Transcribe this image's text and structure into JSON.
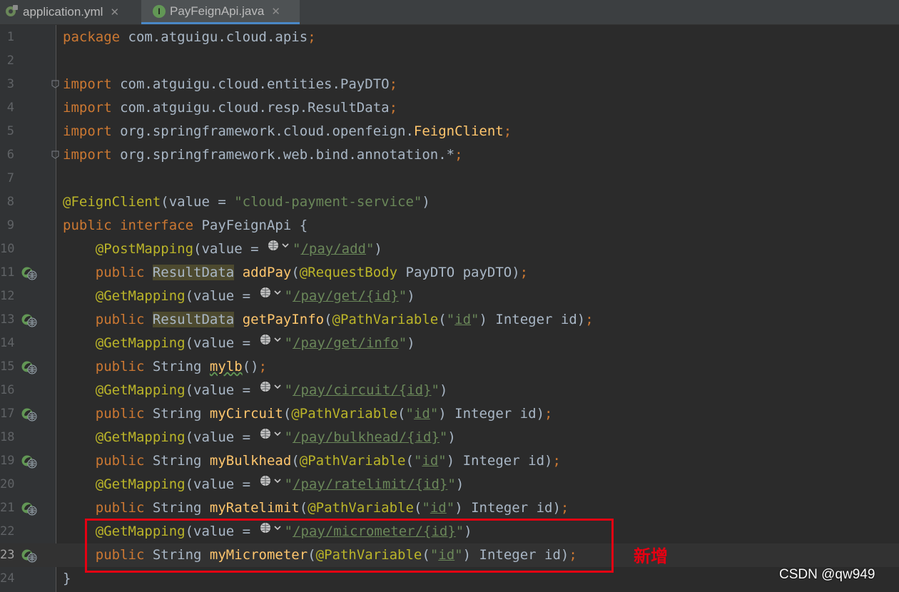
{
  "tabs": [
    {
      "label": "application.yml",
      "icon": "yml-file-icon",
      "active": false
    },
    {
      "label": "PayFeignApi.java",
      "icon": "java-interface-icon",
      "badge": "I",
      "active": true
    }
  ],
  "editor": {
    "current_line": 23,
    "lines": [
      {
        "n": "1",
        "tokens": [
          [
            "kw",
            "package"
          ],
          [
            "p",
            " com.atguigu.cloud.apis"
          ],
          [
            "kw",
            ";"
          ]
        ]
      },
      {
        "n": "2",
        "tokens": []
      },
      {
        "n": "3",
        "fold": true,
        "tokens": [
          [
            "kw",
            "import"
          ],
          [
            "p",
            " com.atguigu.cloud.entities.PayDTO"
          ],
          [
            "kw",
            ";"
          ]
        ]
      },
      {
        "n": "4",
        "tokens": [
          [
            "kw",
            "import"
          ],
          [
            "p",
            " com.atguigu.cloud.resp.ResultData"
          ],
          [
            "kw",
            ";"
          ]
        ]
      },
      {
        "n": "5",
        "tokens": [
          [
            "kw",
            "import"
          ],
          [
            "p",
            " org.springframework.cloud.openfeign."
          ],
          [
            "fn",
            "FeignClient"
          ],
          [
            "kw",
            ";"
          ]
        ]
      },
      {
        "n": "6",
        "fold": true,
        "tokens": [
          [
            "kw",
            "import"
          ],
          [
            "p",
            " org.springframework.web.bind.annotation.*"
          ],
          [
            "kw",
            ";"
          ]
        ]
      },
      {
        "n": "7",
        "tokens": []
      },
      {
        "n": "8",
        "tokens": [
          [
            "ann",
            "@FeignClient"
          ],
          [
            "p",
            "(value = "
          ],
          [
            "str",
            "\"cloud-payment-service\""
          ],
          [
            "p",
            ")"
          ]
        ]
      },
      {
        "n": "9",
        "tokens": [
          [
            "kw",
            "public interface"
          ],
          [
            "p",
            " PayFeignApi {"
          ]
        ]
      },
      {
        "n": "10",
        "tokens": [
          [
            "p",
            "    "
          ],
          [
            "ann",
            "@PostMapping"
          ],
          [
            "p",
            "(value = "
          ],
          [
            "globe",
            ""
          ],
          [
            "str",
            "\""
          ],
          [
            "strul",
            "/pay/add"
          ],
          [
            "str",
            "\""
          ],
          [
            "p",
            ")"
          ]
        ]
      },
      {
        "n": "11",
        "gicon": true,
        "tokens": [
          [
            "p",
            "    "
          ],
          [
            "kw",
            "public "
          ],
          [
            "hl",
            "ResultData"
          ],
          [
            "p",
            " "
          ],
          [
            "fn",
            "addPay"
          ],
          [
            "p",
            "("
          ],
          [
            "ann",
            "@RequestBody"
          ],
          [
            "p",
            " PayDTO payDTO)"
          ],
          [
            "kw",
            ";"
          ]
        ]
      },
      {
        "n": "12",
        "tokens": [
          [
            "p",
            "    "
          ],
          [
            "ann",
            "@GetMapping"
          ],
          [
            "p",
            "(value = "
          ],
          [
            "globe",
            ""
          ],
          [
            "str",
            "\""
          ],
          [
            "strul",
            "/pay/get/{id}"
          ],
          [
            "str",
            "\""
          ],
          [
            "p",
            ")"
          ]
        ]
      },
      {
        "n": "13",
        "gicon": true,
        "tokens": [
          [
            "p",
            "    "
          ],
          [
            "kw",
            "public "
          ],
          [
            "hl",
            "ResultData"
          ],
          [
            "p",
            " "
          ],
          [
            "fn",
            "getPayInfo"
          ],
          [
            "p",
            "("
          ],
          [
            "ann",
            "@PathVariable"
          ],
          [
            "p",
            "("
          ],
          [
            "str",
            "\""
          ],
          [
            "strul",
            "id"
          ],
          [
            "str",
            "\""
          ],
          [
            "p",
            ") Integer id)"
          ],
          [
            "kw",
            ";"
          ]
        ]
      },
      {
        "n": "14",
        "tokens": [
          [
            "p",
            "    "
          ],
          [
            "ann",
            "@GetMapping"
          ],
          [
            "p",
            "(value = "
          ],
          [
            "globe",
            ""
          ],
          [
            "str",
            "\""
          ],
          [
            "strul",
            "/pay/get/info"
          ],
          [
            "str",
            "\""
          ],
          [
            "p",
            ")"
          ]
        ]
      },
      {
        "n": "15",
        "gicon": true,
        "tokens": [
          [
            "p",
            "    "
          ],
          [
            "kw",
            "public "
          ],
          [
            "p",
            "String "
          ],
          [
            "fnw",
            "mylb"
          ],
          [
            "p",
            "()"
          ],
          [
            "kw",
            ";"
          ]
        ]
      },
      {
        "n": "16",
        "tokens": [
          [
            "p",
            "    "
          ],
          [
            "ann",
            "@GetMapping"
          ],
          [
            "p",
            "(value = "
          ],
          [
            "globe",
            ""
          ],
          [
            "str",
            "\""
          ],
          [
            "strul",
            "/pay/circuit/{id}"
          ],
          [
            "str",
            "\""
          ],
          [
            "p",
            ")"
          ]
        ]
      },
      {
        "n": "17",
        "gicon": true,
        "tokens": [
          [
            "p",
            "    "
          ],
          [
            "kw",
            "public "
          ],
          [
            "p",
            "String "
          ],
          [
            "fn",
            "myCircuit"
          ],
          [
            "p",
            "("
          ],
          [
            "ann",
            "@PathVariable"
          ],
          [
            "p",
            "("
          ],
          [
            "str",
            "\""
          ],
          [
            "strul",
            "id"
          ],
          [
            "str",
            "\""
          ],
          [
            "p",
            ") Integer id)"
          ],
          [
            "kw",
            ";"
          ]
        ]
      },
      {
        "n": "18",
        "tokens": [
          [
            "p",
            "    "
          ],
          [
            "ann",
            "@GetMapping"
          ],
          [
            "p",
            "(value = "
          ],
          [
            "globe",
            ""
          ],
          [
            "str",
            "\""
          ],
          [
            "strul",
            "/pay/bulkhead/{id}"
          ],
          [
            "str",
            "\""
          ],
          [
            "p",
            ")"
          ]
        ]
      },
      {
        "n": "19",
        "gicon": true,
        "tokens": [
          [
            "p",
            "    "
          ],
          [
            "kw",
            "public "
          ],
          [
            "p",
            "String "
          ],
          [
            "fn",
            "myBulkhead"
          ],
          [
            "p",
            "("
          ],
          [
            "ann",
            "@PathVariable"
          ],
          [
            "p",
            "("
          ],
          [
            "str",
            "\""
          ],
          [
            "strul",
            "id"
          ],
          [
            "str",
            "\""
          ],
          [
            "p",
            ") Integer id)"
          ],
          [
            "kw",
            ";"
          ]
        ]
      },
      {
        "n": "20",
        "tokens": [
          [
            "p",
            "    "
          ],
          [
            "ann",
            "@GetMapping"
          ],
          [
            "p",
            "(value = "
          ],
          [
            "globe",
            ""
          ],
          [
            "str",
            "\""
          ],
          [
            "strul",
            "/pay/ratelimit/{id}"
          ],
          [
            "str",
            "\""
          ],
          [
            "p",
            ")"
          ]
        ]
      },
      {
        "n": "21",
        "gicon": true,
        "tokens": [
          [
            "p",
            "    "
          ],
          [
            "kw",
            "public "
          ],
          [
            "p",
            "String "
          ],
          [
            "fn",
            "myRatelimit"
          ],
          [
            "p",
            "("
          ],
          [
            "ann",
            "@PathVariable"
          ],
          [
            "p",
            "("
          ],
          [
            "str",
            "\""
          ],
          [
            "strul",
            "id"
          ],
          [
            "str",
            "\""
          ],
          [
            "p",
            ") Integer id)"
          ],
          [
            "kw",
            ";"
          ]
        ]
      },
      {
        "n": "22",
        "tokens": [
          [
            "p",
            "    "
          ],
          [
            "ann",
            "@GetMapping"
          ],
          [
            "p",
            "(value = "
          ],
          [
            "globe",
            ""
          ],
          [
            "str",
            "\""
          ],
          [
            "strul",
            "/pay/micrometer/{id}"
          ],
          [
            "str",
            "\""
          ],
          [
            "p",
            ")"
          ]
        ]
      },
      {
        "n": "23",
        "gicon": true,
        "tokens": [
          [
            "p",
            "    "
          ],
          [
            "kw",
            "public "
          ],
          [
            "p",
            "String "
          ],
          [
            "fn",
            "myMicrometer"
          ],
          [
            "p",
            "("
          ],
          [
            "ann",
            "@PathVariable"
          ],
          [
            "p",
            "("
          ],
          [
            "str",
            "\""
          ],
          [
            "strul",
            "id"
          ],
          [
            "str",
            "\""
          ],
          [
            "p",
            ") Integer id)"
          ],
          [
            "kw",
            ";"
          ]
        ]
      },
      {
        "n": "24",
        "tokens": [
          [
            "p",
            "}"
          ]
        ]
      }
    ]
  },
  "annotation": {
    "note": "新增",
    "color": "#e60012"
  },
  "watermark": "CSDN @qw949",
  "colors": {
    "keyword": "#cc7832",
    "annotation": "#bbb529",
    "string": "#6a8759",
    "method": "#ffc66d",
    "plain": "#a9b7c6"
  }
}
